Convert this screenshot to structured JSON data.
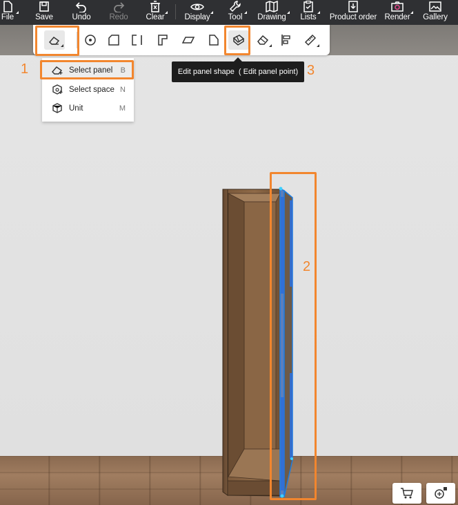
{
  "topbar": {
    "items": [
      {
        "label": "File",
        "icon": "file-icon"
      },
      {
        "label": "Save",
        "icon": "save-icon"
      },
      {
        "label": "Undo",
        "icon": "undo-icon"
      },
      {
        "label": "Redo",
        "icon": "redo-icon"
      },
      {
        "label": "Clear",
        "icon": "clear-icon"
      },
      {
        "label": "Display",
        "icon": "eye-icon"
      },
      {
        "label": "Tool",
        "icon": "wrench-icon"
      },
      {
        "label": "Drawing",
        "icon": "map-icon"
      },
      {
        "label": "Lists",
        "icon": "clipboard-icon"
      },
      {
        "label": "Product order",
        "icon": "download-doc-icon"
      },
      {
        "label": "Render",
        "icon": "camera-icon"
      },
      {
        "label": "Gallery",
        "icon": "image-icon"
      }
    ]
  },
  "dropdown": {
    "items": [
      {
        "label": "Select panel",
        "key": "B"
      },
      {
        "label": "Select space",
        "key": "N"
      },
      {
        "label": "Unit",
        "key": "M"
      }
    ]
  },
  "tooltip": {
    "text": "Edit panel shape  ( Edit panel point)"
  },
  "callouts": {
    "one": "1",
    "two": "2",
    "three": "3"
  },
  "colors": {
    "highlight": "#f2862e",
    "topbar": "#2f3033",
    "selection": "#1e7de0"
  }
}
